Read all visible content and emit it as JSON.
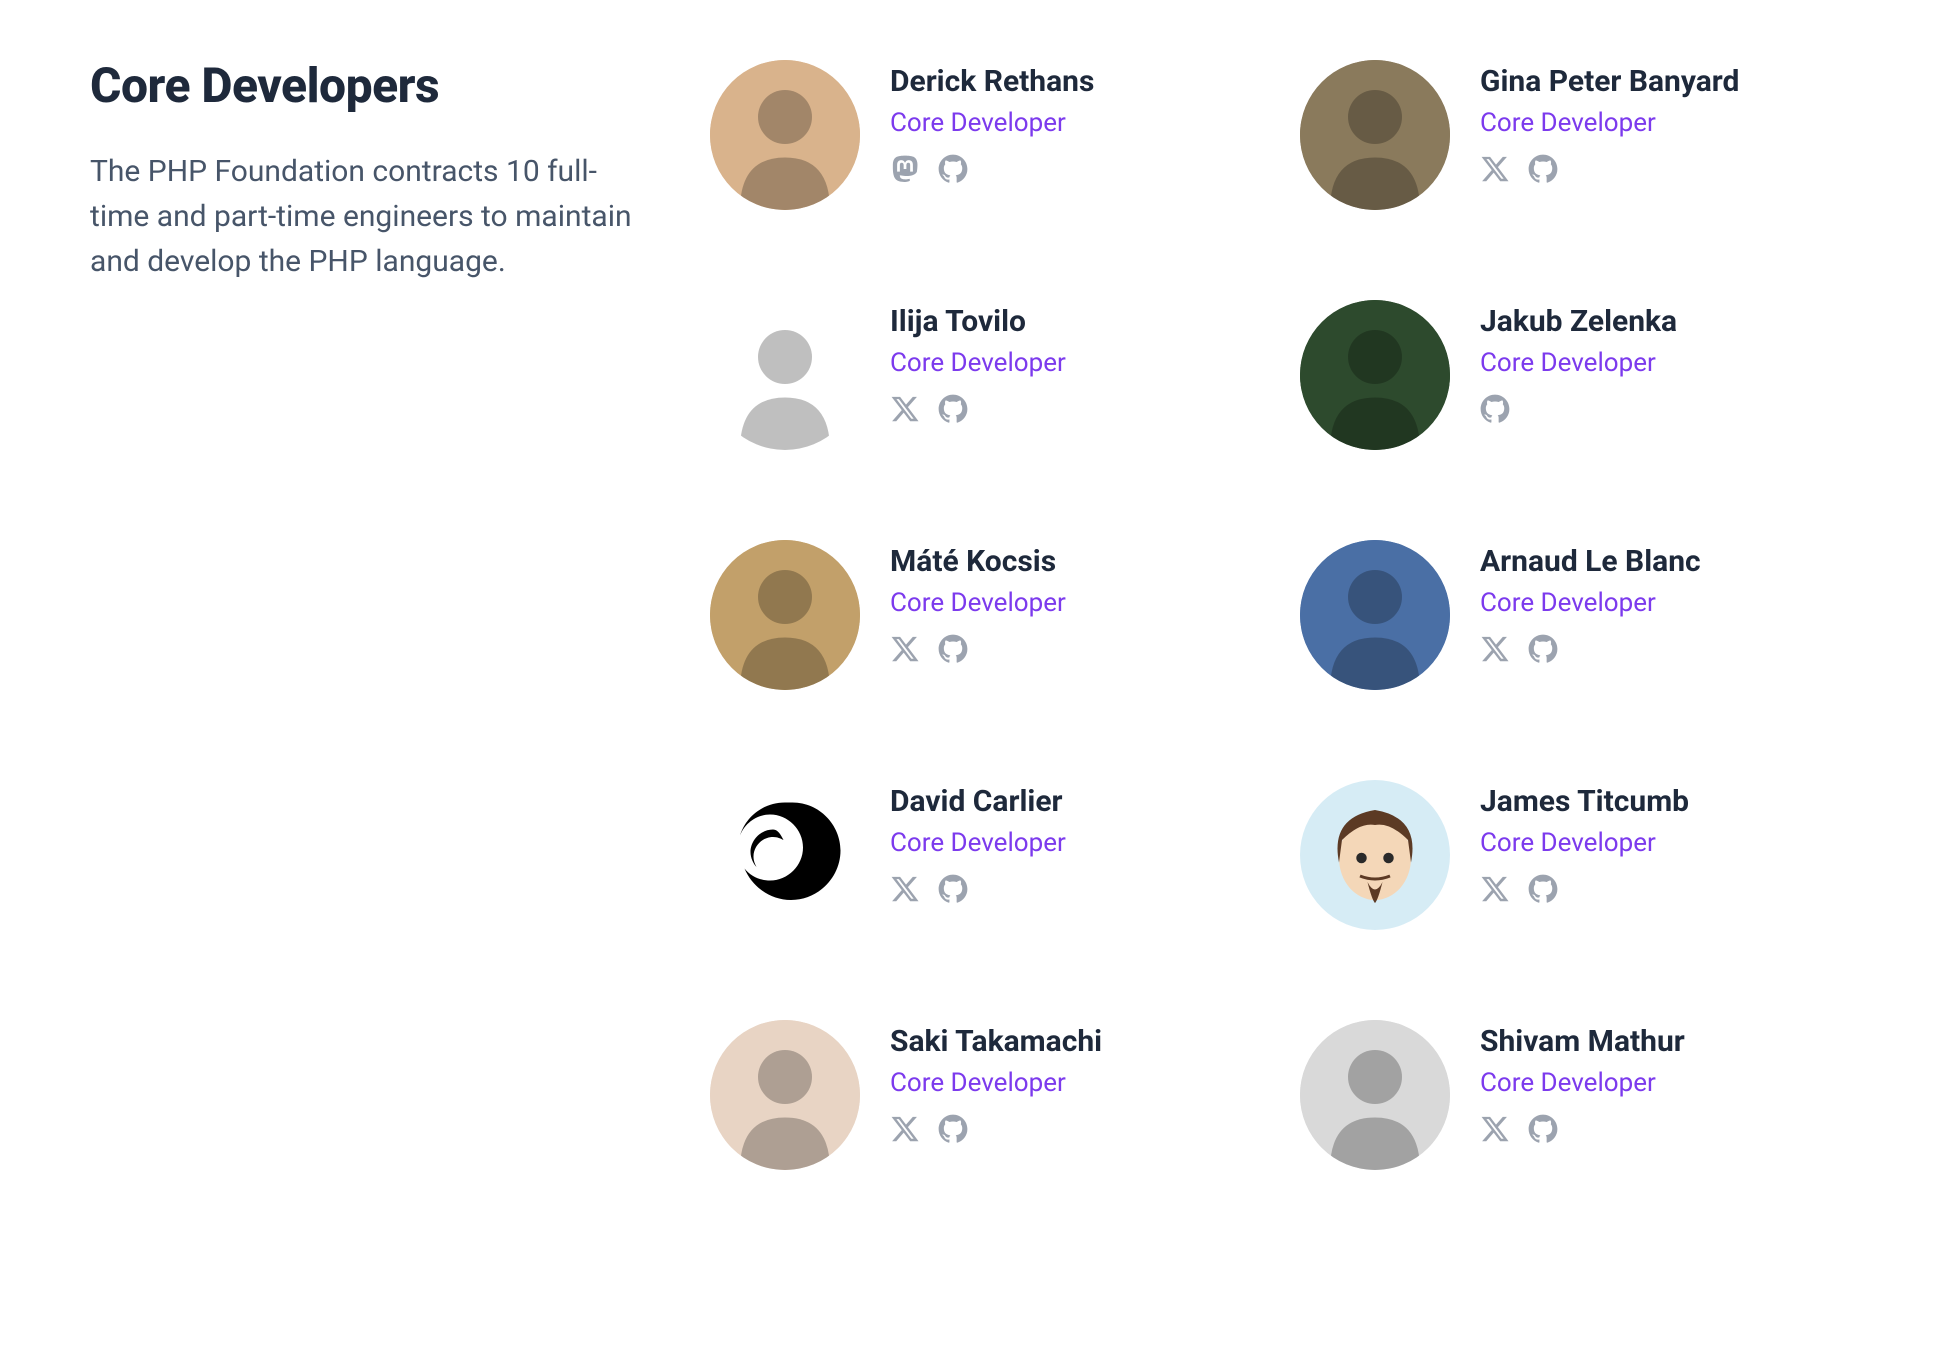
{
  "heading": "Core Developers",
  "description": "The PHP Foundation contracts 10 full-time and part-time engineers to maintain and develop the PHP language.",
  "role_label": "Core Developer",
  "colors": {
    "role": "#7c3aed",
    "text_dark": "#1e293b",
    "text_muted": "#475569",
    "icon": "#9ca3af"
  },
  "developers": [
    {
      "name": "Derick Rethans",
      "socials": [
        "mastodon",
        "github"
      ],
      "avatar_bg": "#d9b38c"
    },
    {
      "name": "Gina Peter Banyard",
      "socials": [
        "x",
        "github"
      ],
      "avatar_bg": "#8a7a5c"
    },
    {
      "name": "Ilija Tovilo",
      "socials": [
        "x",
        "github"
      ],
      "avatar_bg": "#ffffff"
    },
    {
      "name": "Jakub Zelenka",
      "socials": [
        "github"
      ],
      "avatar_bg": "#2d4a2d"
    },
    {
      "name": "Máté Kocsis",
      "socials": [
        "x",
        "github"
      ],
      "avatar_bg": "#c2a06a"
    },
    {
      "name": "Arnaud Le Blanc",
      "socials": [
        "x",
        "github"
      ],
      "avatar_bg": "#4a6fa5"
    },
    {
      "name": "David Carlier",
      "socials": [
        "x",
        "github"
      ],
      "avatar_bg": "#ffffff"
    },
    {
      "name": "James Titcumb",
      "socials": [
        "x",
        "github"
      ],
      "avatar_bg": "#d6ecf5"
    },
    {
      "name": "Saki Takamachi",
      "socials": [
        "x",
        "github"
      ],
      "avatar_bg": "#e8d4c4"
    },
    {
      "name": "Shivam Mathur",
      "socials": [
        "x",
        "github"
      ],
      "avatar_bg": "#d9d9d9"
    }
  ]
}
